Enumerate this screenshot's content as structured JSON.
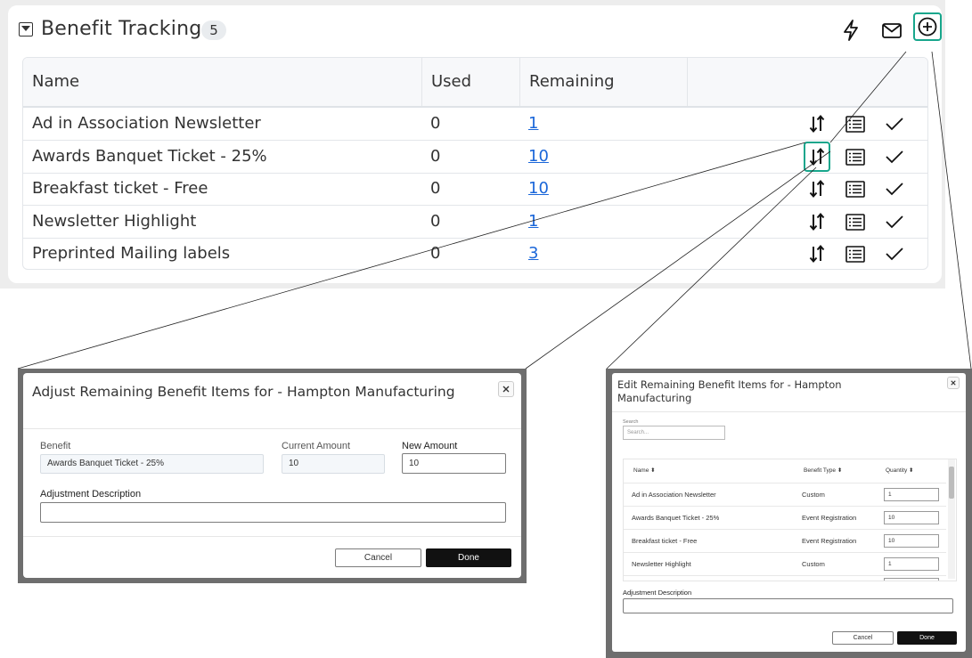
{
  "panel": {
    "title": "Benefit Tracking",
    "count": "5",
    "columns": [
      "Name",
      "Used",
      "Remaining"
    ],
    "rows": [
      {
        "name": "Ad in Association Newsletter",
        "used": "0",
        "remaining": "1"
      },
      {
        "name": "Awards Banquet Ticket - 25%",
        "used": "0",
        "remaining": "10"
      },
      {
        "name": "Breakfast ticket - Free",
        "used": "0",
        "remaining": "10"
      },
      {
        "name": "Newsletter Highlight",
        "used": "0",
        "remaining": "1"
      },
      {
        "name": "Preprinted Mailing labels",
        "used": "0",
        "remaining": "3"
      }
    ],
    "icons": {
      "quick": "lightning-icon",
      "email": "envelope-icon",
      "add": "plus-circle-icon",
      "adjust": "sort-arrows-icon",
      "list": "list-icon",
      "check": "checkmark-icon"
    },
    "accent_color": "#18a68c",
    "link_color": "#1a66d9"
  },
  "adjust_dialog": {
    "title": "Adjust Remaining Benefit Items for - Hampton Manufacturing",
    "benefit_label": "Benefit",
    "benefit_value": "Awards Banquet Ticket - 25%",
    "current_label": "Current Amount",
    "current_value": "10",
    "new_label": "New Amount",
    "new_value": "10",
    "desc_label": "Adjustment Description",
    "cancel": "Cancel",
    "done": "Done"
  },
  "edit_dialog": {
    "title": "Edit Remaining Benefit Items for - Hampton Manufacturing",
    "search_label": "Search",
    "search_placeholder": "Search...",
    "columns": [
      "Name",
      "Benefit Type",
      "Quantity"
    ],
    "rows": [
      {
        "name": "Ad in Association Newsletter",
        "type": "Custom",
        "qty": "1"
      },
      {
        "name": "Awards Banquet Ticket - 25%",
        "type": "Event Registration",
        "qty": "10"
      },
      {
        "name": "Breakfast ticket - Free",
        "type": "Event Registration",
        "qty": "10"
      },
      {
        "name": "Newsletter Highlight",
        "type": "Custom",
        "qty": "1"
      }
    ],
    "desc_label": "Adjustment Description",
    "cancel": "Cancel",
    "done": "Done"
  }
}
